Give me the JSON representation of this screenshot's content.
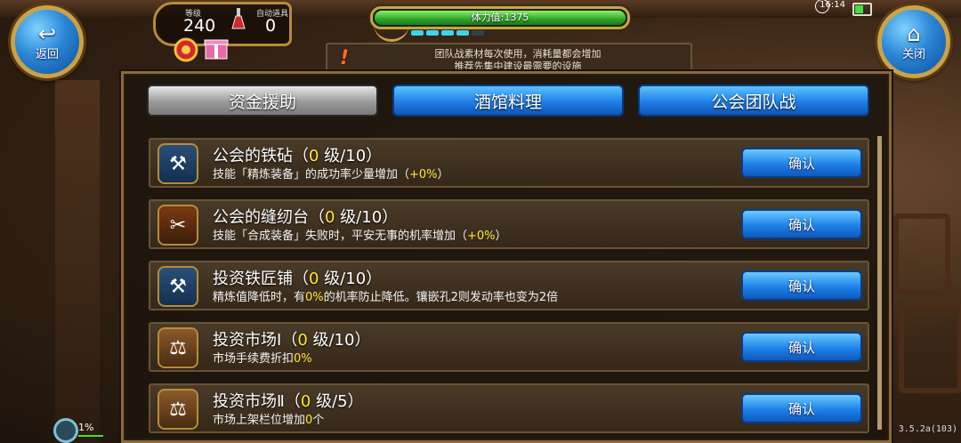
{
  "nav": {
    "back_label": "返回",
    "close_label": "关闭"
  },
  "player": {
    "level_label": "等级",
    "level_value": "240",
    "auto_item_label": "自动道具",
    "auto_item_value": "0"
  },
  "stamina": {
    "label": "体力值:1375",
    "fill_percent": 100
  },
  "status": {
    "time": "16:14"
  },
  "notice": {
    "line1": "团队战素材每次使用，消耗量都会增加",
    "line2": "推荐先集中建设最需要的设施"
  },
  "tabs": [
    {
      "label": "资金援助",
      "active": false
    },
    {
      "label": "酒馆料理",
      "active": true
    },
    {
      "label": "公会团队战",
      "active": true
    }
  ],
  "items": [
    {
      "icon": "anvil-icon",
      "name": "公会的铁砧",
      "open": "（",
      "level": "0",
      "max": " 级/10）",
      "desc_a": "技能「精炼装备」的成功率少量增加（",
      "desc_hl": "+0%",
      "desc_b": "）",
      "button": "确认"
    },
    {
      "icon": "sewing-table-icon",
      "name": "公会的缝纫台",
      "open": "（",
      "level": "0",
      "max": " 级/10）",
      "desc_a": "技能「合成装备」失败时，平安无事的机率增加（",
      "desc_hl": "+0%",
      "desc_b": "）",
      "button": "确认"
    },
    {
      "icon": "anvil-icon",
      "name": "投资铁匠铺",
      "open": "（",
      "level": "0",
      "max": " 级/10）",
      "desc_a": "精炼值降低时，有",
      "desc_hl": "0%",
      "desc_b": "的机率防止降低。镶嵌孔2则发动率也变为2倍",
      "button": "确认"
    },
    {
      "icon": "market-icon",
      "name": "投资市场Ⅰ",
      "open": "（",
      "level": "0",
      "max": " 级/10）",
      "desc_a": "市场手续费折扣",
      "desc_hl": "0%",
      "desc_b": "",
      "button": "确认"
    },
    {
      "icon": "market-icon",
      "name": "投资市场Ⅱ",
      "open": "（",
      "level": "0",
      "max": " 级/5）",
      "desc_a": "市场上架栏位增加",
      "desc_hl": "0",
      "desc_b": "个",
      "button": "确认"
    }
  ],
  "footer": {
    "percent": "1%",
    "version": "3.5.2a(103)"
  }
}
